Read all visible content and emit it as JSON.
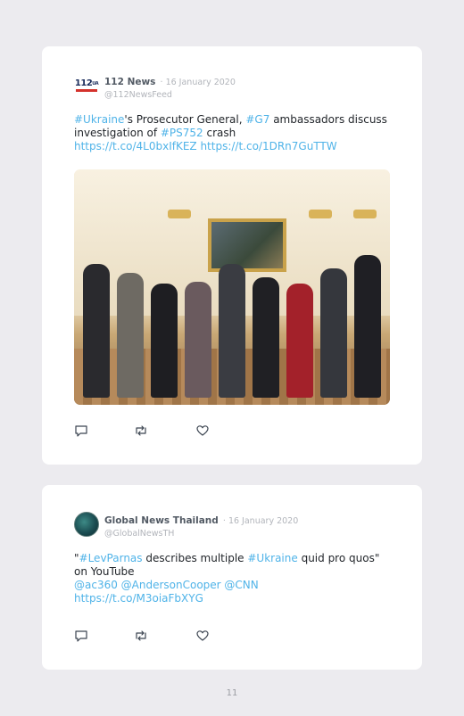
{
  "tweets": [
    {
      "author": "112 News",
      "date": "· 16 January 2020",
      "handle": "@112NewsFeed",
      "avatar_icon": "112-ua-logo",
      "text_parts": [
        {
          "t": "#Ukraine",
          "link": true
        },
        {
          "t": "'s Prosecutor General, ",
          "link": false
        },
        {
          "t": "#G7",
          "link": true
        },
        {
          "t": " ambassadors discuss investigation of ",
          "link": false
        },
        {
          "t": "#PS752",
          "link": true
        },
        {
          "t": " crash",
          "link": false
        }
      ],
      "links_line": "https://t.co/4L0bxIfKEZ https://t.co/1DRn7GuTTW",
      "has_photo": true
    },
    {
      "author": "Global News Thailand",
      "date": "· 16 January 2020",
      "handle": "@GlobalNewsTH",
      "avatar_icon": "globe-avatar",
      "line1_parts": [
        {
          "t": "\"",
          "link": false
        },
        {
          "t": "#LevParnas",
          "link": true
        },
        {
          "t": " describes multiple ",
          "link": false
        },
        {
          "t": "#Ukraine",
          "link": true
        },
        {
          "t": " quid pro quos\"",
          "link": false
        }
      ],
      "line2": "on YouTube",
      "line3": "@ac360 @AndersonCooper @CNN",
      "line4": "https://t.co/M3oiaFbXYG"
    }
  ],
  "actions": [
    "reply-icon",
    "retweet-icon",
    "like-icon"
  ],
  "page_number": "11",
  "colors": {
    "link": "#4fb3e8",
    "background": "#ecebef",
    "card": "#ffffff"
  }
}
